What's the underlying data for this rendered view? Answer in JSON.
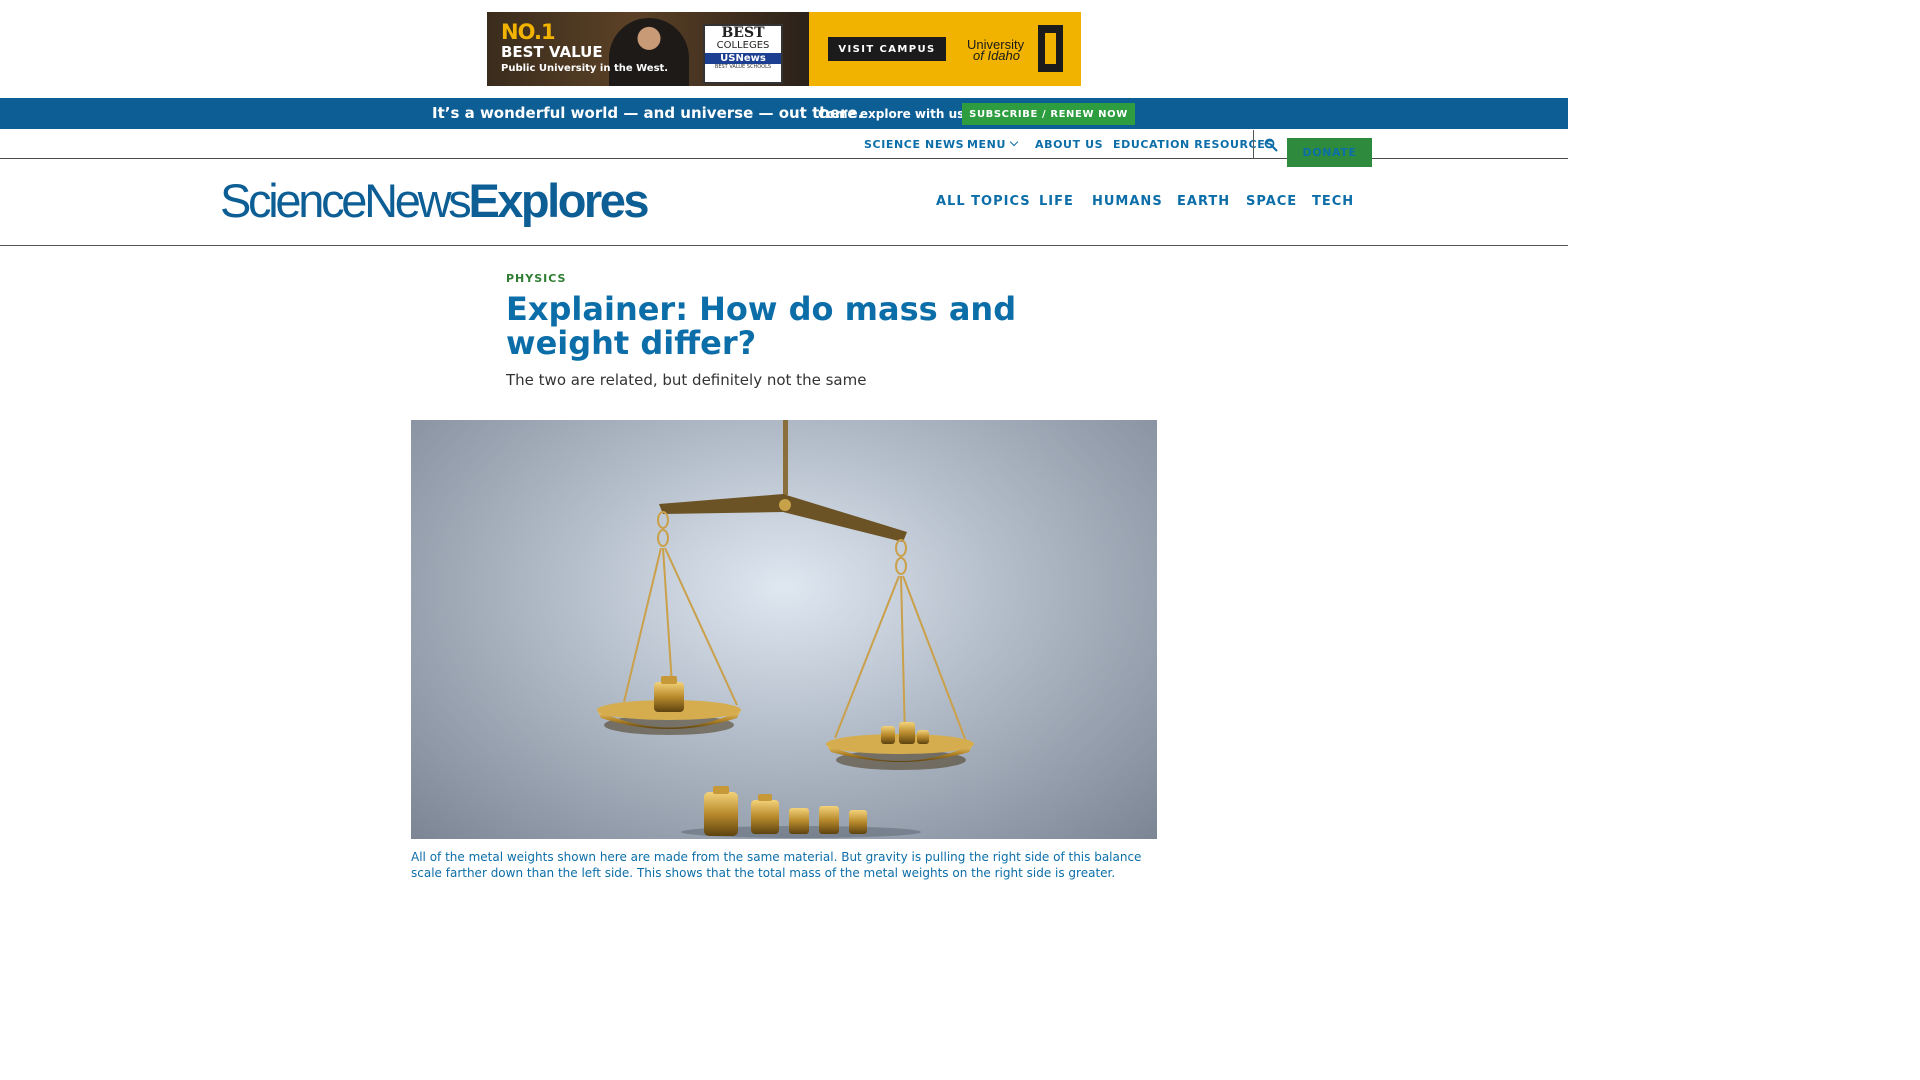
{
  "ad": {
    "headline_no1": "NO.1",
    "headline_best": "BEST VALUE",
    "headline_sub": "Public University in the West.",
    "badge_line1": "BEST",
    "badge_line2": "COLLEGES",
    "badge_brand": "USNews",
    "badge_small": "BEST VALUE SCHOOLS",
    "cta": "VISIT CAMPUS",
    "university_line1": "University",
    "university_line2": "of Idaho",
    "colors": {
      "gold": "#f1b300",
      "dark": "#1b1b1b"
    }
  },
  "promo": {
    "message": "It’s a wonderful world — and universe — out there.",
    "sub": "Come explore with us!",
    "button": "SUBSCRIBE / RENEW NOW"
  },
  "utility_nav": {
    "items": [
      "SCIENCE NEWS",
      "MENU",
      "ABOUT US",
      "EDUCATION RESOURCES"
    ],
    "search_icon": "search-icon",
    "donate": "DONATE"
  },
  "header": {
    "logo_light": "ScienceNews",
    "logo_bold": "Explores",
    "nav": [
      "ALL TOPICS",
      "LIFE",
      "HUMANS",
      "EARTH",
      "SPACE",
      "TECH"
    ]
  },
  "article": {
    "category": "PHYSICS",
    "title": "Explainer: How do mass and weight differ?",
    "dek": "The two are related, but definitely not the same",
    "caption": "All of the metal weights shown here are made from the same material. But gravity is pulling the right side of this balance scale farther down than the left side. This shows that the total mass of the metal weights on the right side is greater."
  },
  "colors": {
    "brand_blue": "#0c5e95",
    "link_blue": "#0c6ea8",
    "green": "#2e8b3e"
  }
}
